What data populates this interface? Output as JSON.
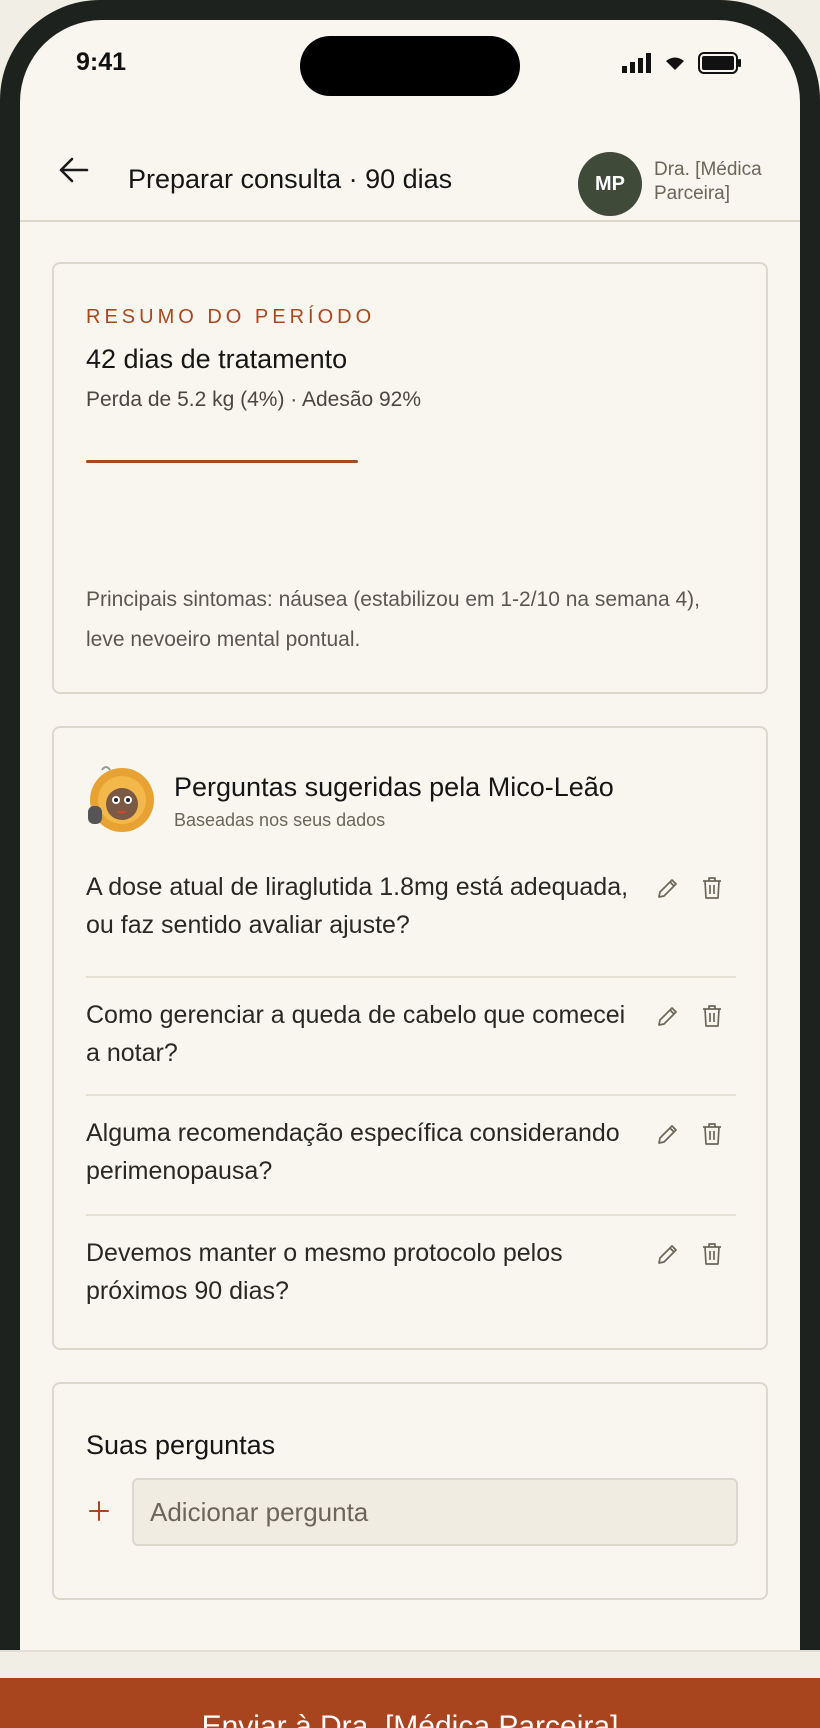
{
  "status_bar": {
    "time": "9:41"
  },
  "header": {
    "title": "Preparar consulta · 90 dias",
    "avatar_initials": "MP",
    "doctor_name": "Dra. [Médica Parceira]"
  },
  "summary": {
    "eyebrow": "RESUMO DO PERÍODO",
    "title": "42 dias de tratamento",
    "subtitle": "Perda de 5.2 kg (4%) · Adesão 92%",
    "symptoms": "Principais sintomas: náusea (estabilizou em 1-2/10 na semana 4), leve nevoeiro mental pontual."
  },
  "suggested": {
    "title": "Perguntas sugeridas pela Mico-Leão",
    "subtitle": "Baseadas nos seus dados",
    "questions": [
      "A dose atual de liraglutida 1.8mg está adequada, ou faz sentido avaliar ajuste?",
      "Como gerenciar a queda de cabelo que comecei a notar?",
      "Alguma recomendação específica considerando perimenopausa?",
      "Devemos manter o mesmo protocolo pelos próximos 90 dias?"
    ]
  },
  "your_questions": {
    "title": "Suas perguntas",
    "input_placeholder": "Adicionar pergunta"
  },
  "send_button_label": "Enviar à Dra. [Médica Parceira]",
  "icons": [
    "back-arrow-icon",
    "pencil-icon",
    "trash-icon",
    "plus-icon",
    "mico-leao-icon",
    "signal-icon",
    "wifi-icon",
    "battery-icon"
  ],
  "colors": {
    "accent": "#a9481f",
    "avatar": "#3f4a38",
    "background": "#f8f6ee"
  }
}
